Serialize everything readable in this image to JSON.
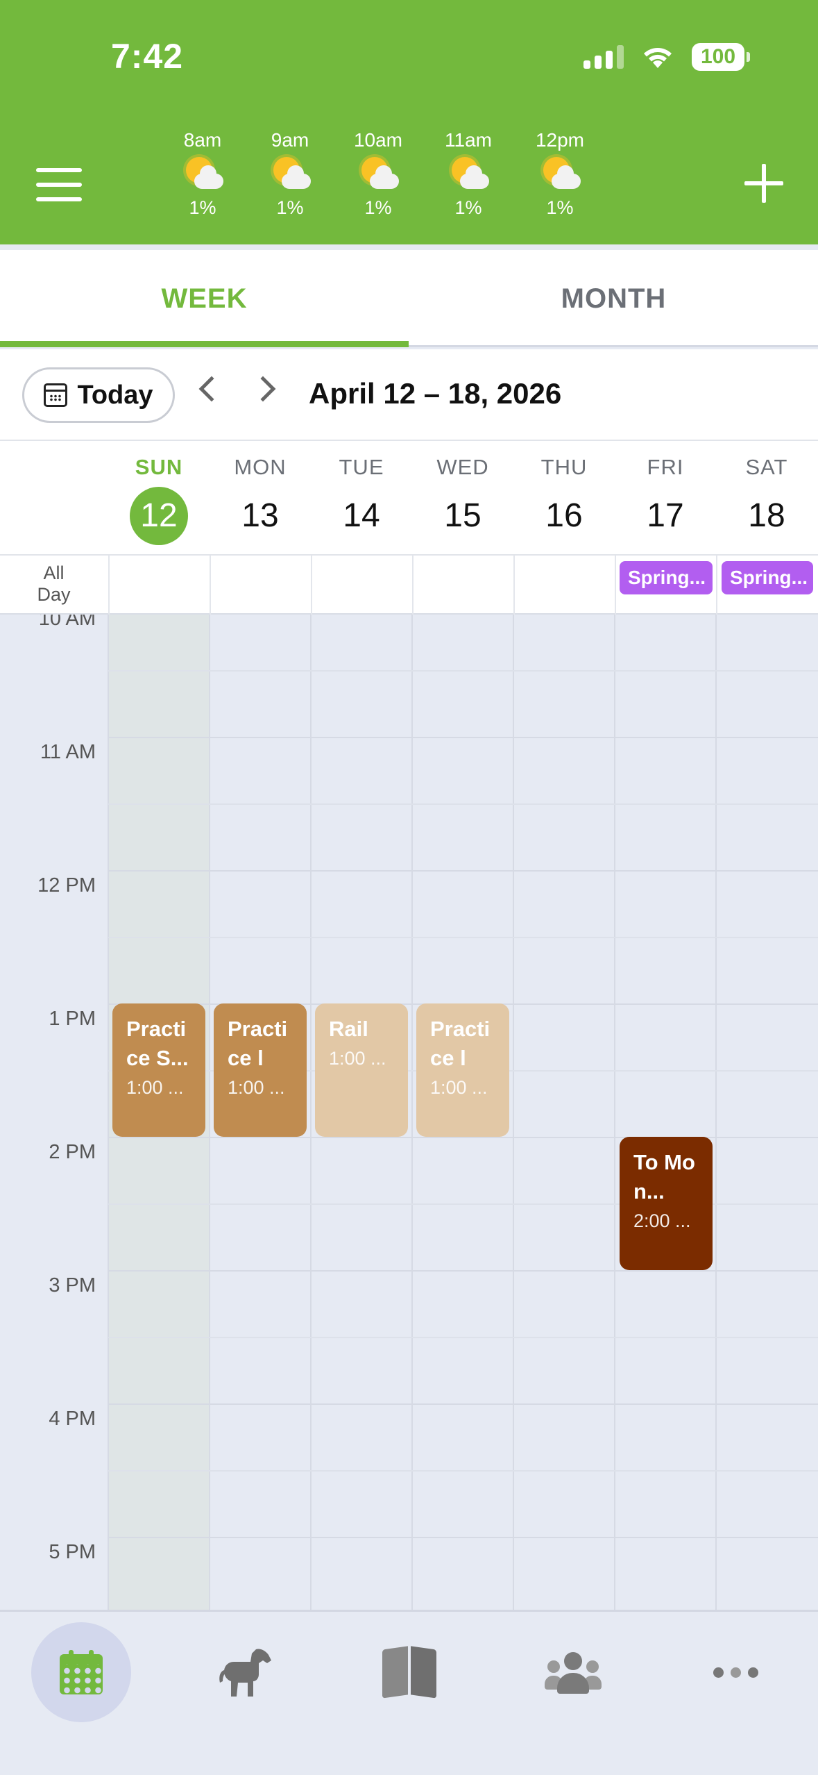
{
  "status_bar": {
    "time": "7:42",
    "battery": "100"
  },
  "colors": {
    "brand_green": "#73b93d",
    "event_tan": "#c08c50",
    "event_light_tan": "#e2c8a6",
    "event_brown": "#7b2c00",
    "all_day_purple": "#b25ef0"
  },
  "weather": [
    {
      "hour": "8am",
      "pct": "1%",
      "icon": "partly-sunny-icon"
    },
    {
      "hour": "9am",
      "pct": "1%",
      "icon": "partly-sunny-icon"
    },
    {
      "hour": "10am",
      "pct": "1%",
      "icon": "partly-sunny-icon"
    },
    {
      "hour": "11am",
      "pct": "1%",
      "icon": "partly-sunny-icon"
    },
    {
      "hour": "12pm",
      "pct": "1%",
      "icon": "partly-sunny-icon"
    }
  ],
  "tabs": [
    {
      "label": "WEEK",
      "active": true
    },
    {
      "label": "MONTH",
      "active": false
    }
  ],
  "toolbar": {
    "today_label": "Today",
    "range_label": "April 12 – 18, 2026"
  },
  "days": [
    {
      "name": "SUN",
      "num": "12",
      "today": true
    },
    {
      "name": "MON",
      "num": "13"
    },
    {
      "name": "TUE",
      "num": "14"
    },
    {
      "name": "WED",
      "num": "15"
    },
    {
      "name": "THU",
      "num": "16"
    },
    {
      "name": "FRI",
      "num": "17"
    },
    {
      "name": "SAT",
      "num": "18"
    }
  ],
  "all_day": {
    "label_line1": "All",
    "label_line2": "Day",
    "events": [
      {
        "day": "FRI",
        "title": "Spring..."
      },
      {
        "day": "SAT",
        "title": "Spring..."
      }
    ]
  },
  "time_labels": [
    "10 AM",
    "11 AM",
    "12 PM",
    "1 PM",
    "2 PM",
    "3 PM",
    "4 PM",
    "5 PM"
  ],
  "events": [
    {
      "day": "SUN",
      "title": "Practi ce S...",
      "time": "1:00 ..."
    },
    {
      "day": "MON",
      "title": "Practi ce lo...",
      "time": "1:00 ..."
    },
    {
      "day": "TUE",
      "title": "Rail",
      "time": "1:00 ..."
    },
    {
      "day": "WED",
      "title": "Practi ce le...",
      "time": "1:00 ..."
    },
    {
      "day": "FRI",
      "title": "To Mon...",
      "time": "2:00 ..."
    }
  ],
  "bottom_nav": [
    {
      "name": "calendar",
      "icon": "calendar-icon",
      "active": true
    },
    {
      "name": "horses",
      "icon": "horse-icon"
    },
    {
      "name": "journal",
      "icon": "book-icon"
    },
    {
      "name": "people",
      "icon": "people-icon"
    },
    {
      "name": "more",
      "icon": "more-dots-icon"
    }
  ]
}
